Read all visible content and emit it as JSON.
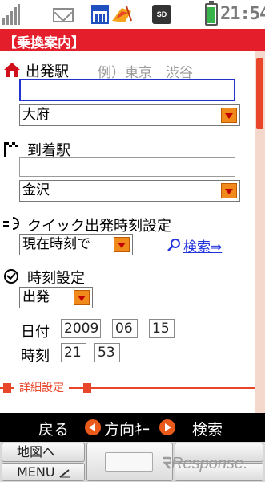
{
  "status_bar": {
    "time": "21:54",
    "sd_label": "SD",
    "battery_level": 0.9,
    "icons": [
      "antenna-icon",
      "mail-icon",
      "calendar-icon",
      "flag-icon",
      "sd-card-icon",
      "battery-icon"
    ]
  },
  "header": {
    "title": "【乗換案内】"
  },
  "departure": {
    "label": "出発駅",
    "example": "例）東京　渋谷",
    "input_value": "",
    "select_value": "大府"
  },
  "arrival": {
    "label": "到着駅",
    "input_value": "",
    "select_value": "金沢"
  },
  "quick_time": {
    "label": "クイック出発時刻設定",
    "select_value": "現在時刻で",
    "search_link": "検索⇒"
  },
  "time_setting": {
    "label": "時刻設定",
    "mode_value": "出発",
    "date_label": "日付",
    "year": "2009",
    "month": "06",
    "day": "15",
    "time_label": "時刻",
    "hour": "21",
    "minute": "53"
  },
  "detail_section": {
    "label": "詳細設定"
  },
  "softkeys": {
    "left": "戻る",
    "center": "方向ｷｰ",
    "right": "検索"
  },
  "function_keys": {
    "map": "地図へ",
    "menu": "MENU"
  },
  "watermark": "Response.",
  "colors": {
    "accent": "#e41e2a",
    "focus": "#2233cc",
    "link": "#2233dd",
    "dropdown": "#f08a1a"
  }
}
